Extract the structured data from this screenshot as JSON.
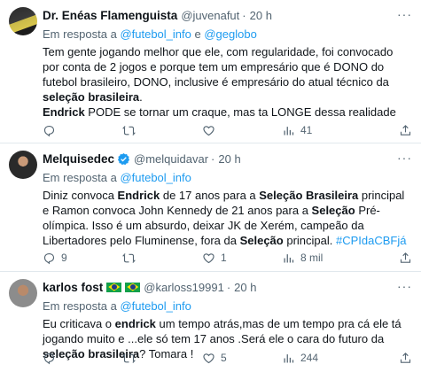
{
  "colors": {
    "link": "#1d9bf0",
    "muted": "#536471",
    "text": "#0f1419",
    "divider": "#e1e8ed"
  },
  "tweets": [
    {
      "name": "Dr. Enéas Flamenguista",
      "handle": "@juvenafut",
      "dot": "·",
      "time": "20 h",
      "reply_prefix": "Em resposta a ",
      "reply_mentions": [
        "@futebol_info",
        "@geglobo"
      ],
      "reply_joiner": " e ",
      "body_segments": [
        "Tem gente jogando melhor que ele, com regularidade, foi convocado por conta de 2 jogos e porque tem um empresário que é DONO do futebol brasileiro, DONO, inclusive é empresário do atual técnico da ",
        "seleção brasileira",
        ".",
        "Endrick",
        " PODE se tornar um craque, mas ta LONGE dessa realidade"
      ],
      "replies": "",
      "retweets": "",
      "likes": "",
      "views": "41"
    },
    {
      "name": "Melquisedec",
      "handle": "@melquidavar",
      "dot": "·",
      "time": "20 h",
      "reply_prefix": "Em resposta a ",
      "reply_mentions": [
        "@futebol_info"
      ],
      "body_segments": [
        "Diniz convoca ",
        "Endrick",
        " de 17 anos para a ",
        "Seleção Brasileira",
        " principal e Ramon convoca John Kennedy de 21 anos para a ",
        "Seleção",
        " Pré-olímpica. Isso é um absurdo, deixar JK de Xerém, campeão da Libertadores pelo Fluminense, fora da ",
        "Seleção",
        " principal. ",
        "#CPIdaCBFjá"
      ],
      "replies": "9",
      "retweets": "",
      "likes": "1",
      "views": "8 mil"
    },
    {
      "name": "karlos fost",
      "handle": "@karloss19991",
      "dot": "·",
      "time": "20 h",
      "reply_prefix": "Em resposta a ",
      "reply_mentions": [
        "@futebol_info"
      ],
      "body_segments": [
        "Eu criticava o ",
        "endrick",
        " um tempo atrás,mas de um tempo pra cá ele tá jogando muito e ...ele só tem 17 anos .Será ele o cara do futuro da ",
        "seleção brasileira",
        "? Tomara !"
      ],
      "replies": "",
      "retweets": "",
      "likes": "5",
      "views": "244"
    }
  ],
  "icons": {
    "more": "more-horizontal-icon",
    "reply": "reply-icon",
    "retweet": "retweet-icon",
    "like": "heart-icon",
    "views": "views-icon",
    "share": "share-icon",
    "verified": "verified-badge-icon",
    "flag": "brazil-flag-icon"
  }
}
